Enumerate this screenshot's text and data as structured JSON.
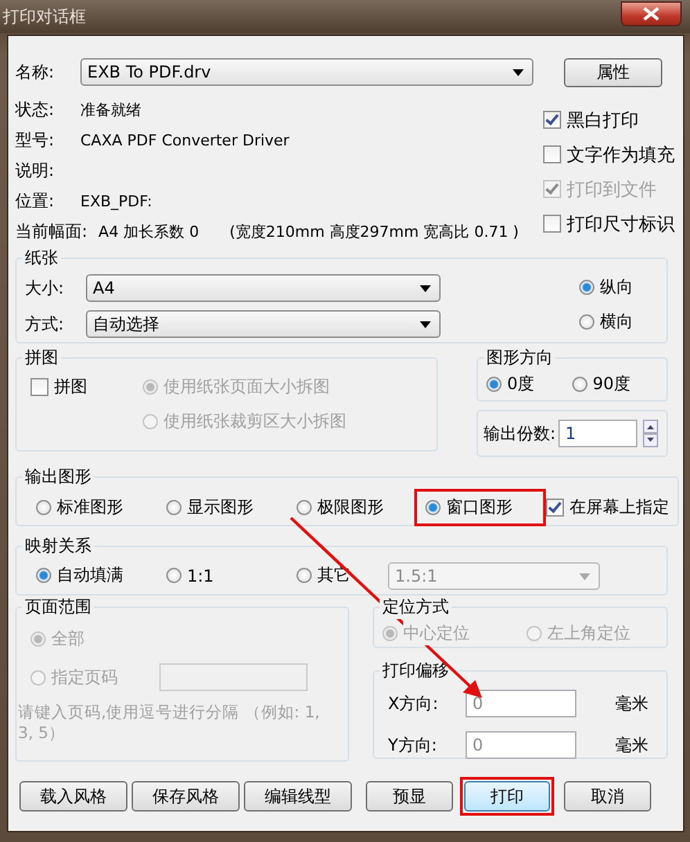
{
  "window": {
    "title": "打印对话框"
  },
  "printer": {
    "name_label": "名称:",
    "name": "EXB To PDF.drv",
    "properties_button": "属性",
    "info": [
      {
        "label": "状态:",
        "value": "准备就绪"
      },
      {
        "label": "型号:",
        "value": "CAXA PDF Converter Driver"
      },
      {
        "label": "说明:"
      },
      {
        "label": "位置:",
        "value": "EXB_PDF:"
      }
    ],
    "current_paper": {
      "label": "当前幅面:",
      "value": "A4  加长系数 0",
      "dims": "(宽度210mm  高度297mm  宽高比 0.71 )"
    }
  },
  "options": [
    {
      "label": "黑白打印",
      "checked": true,
      "disabled": false
    },
    {
      "label": "文字作为填充",
      "checked": false,
      "disabled": false
    },
    {
      "label": "打印到文件",
      "checked": true,
      "disabled": true
    },
    {
      "label": "打印尺寸标识",
      "checked": false,
      "disabled": false
    }
  ],
  "paper": {
    "title": "纸张",
    "size_label": "大小:",
    "size": "A4",
    "mode_label": "方式:",
    "mode": "自动选择",
    "orientation": [
      {
        "label": "纵向",
        "selected": true
      },
      {
        "label": "横向",
        "selected": false
      }
    ]
  },
  "tiling": {
    "title": "拼图",
    "checkbox": {
      "label": "拼图",
      "checked": false
    },
    "options": [
      {
        "label": "使用纸张页面大小拆图",
        "selected": true,
        "disabled": true
      },
      {
        "label": "使用纸张裁剪区大小拆图",
        "selected": false,
        "disabled": true
      }
    ]
  },
  "figure_direction": {
    "title": "图形方向",
    "options": [
      {
        "label": "0度",
        "selected": true
      },
      {
        "label": "90度",
        "selected": false
      }
    ]
  },
  "copies": {
    "label": "输出份数:",
    "value": "1"
  },
  "output": {
    "title": "输出图形",
    "options": [
      {
        "label": "标准图形",
        "selected": false,
        "highlighted": false
      },
      {
        "label": "显示图形",
        "selected": false,
        "highlighted": false
      },
      {
        "label": "极限图形",
        "selected": false,
        "highlighted": false
      },
      {
        "label": "窗口图形",
        "selected": true,
        "highlighted": true
      }
    ],
    "on_screen": {
      "label": "在屏幕上指定",
      "checked": true
    }
  },
  "mapping": {
    "title": "映射关系",
    "options": [
      {
        "label": "自动填满",
        "selected": true
      },
      {
        "label": "1:1",
        "selected": false
      },
      {
        "label": "其它",
        "selected": false
      }
    ],
    "ratio": "1.5:1"
  },
  "page_range": {
    "title": "页面范围",
    "options": [
      {
        "label": "全部",
        "selected": true,
        "disabled": true
      },
      {
        "label": "指定页码",
        "selected": false,
        "disabled": true
      }
    ],
    "hint": "请键入页码,使用逗号进行分隔 （例如: 1, 3, 5）"
  },
  "positioning": {
    "title": "定位方式",
    "options": [
      {
        "label": "中心定位",
        "selected": true,
        "disabled": true
      },
      {
        "label": "左上角定位",
        "selected": false,
        "disabled": true
      }
    ]
  },
  "offset": {
    "title": "打印偏移",
    "rows": [
      {
        "label": "X方向:",
        "value": "0",
        "unit": "毫米"
      },
      {
        "label": "Y方向:",
        "value": "0",
        "unit": "毫米"
      }
    ]
  },
  "buttons": [
    {
      "label": "载入风格",
      "highlighted": false
    },
    {
      "label": "保存风格",
      "highlighted": false
    },
    {
      "label": "编辑线型",
      "highlighted": false
    },
    {
      "label": "预显",
      "highlighted": false
    },
    {
      "label": "打印",
      "highlighted": true
    },
    {
      "label": "取消",
      "highlighted": false
    }
  ]
}
